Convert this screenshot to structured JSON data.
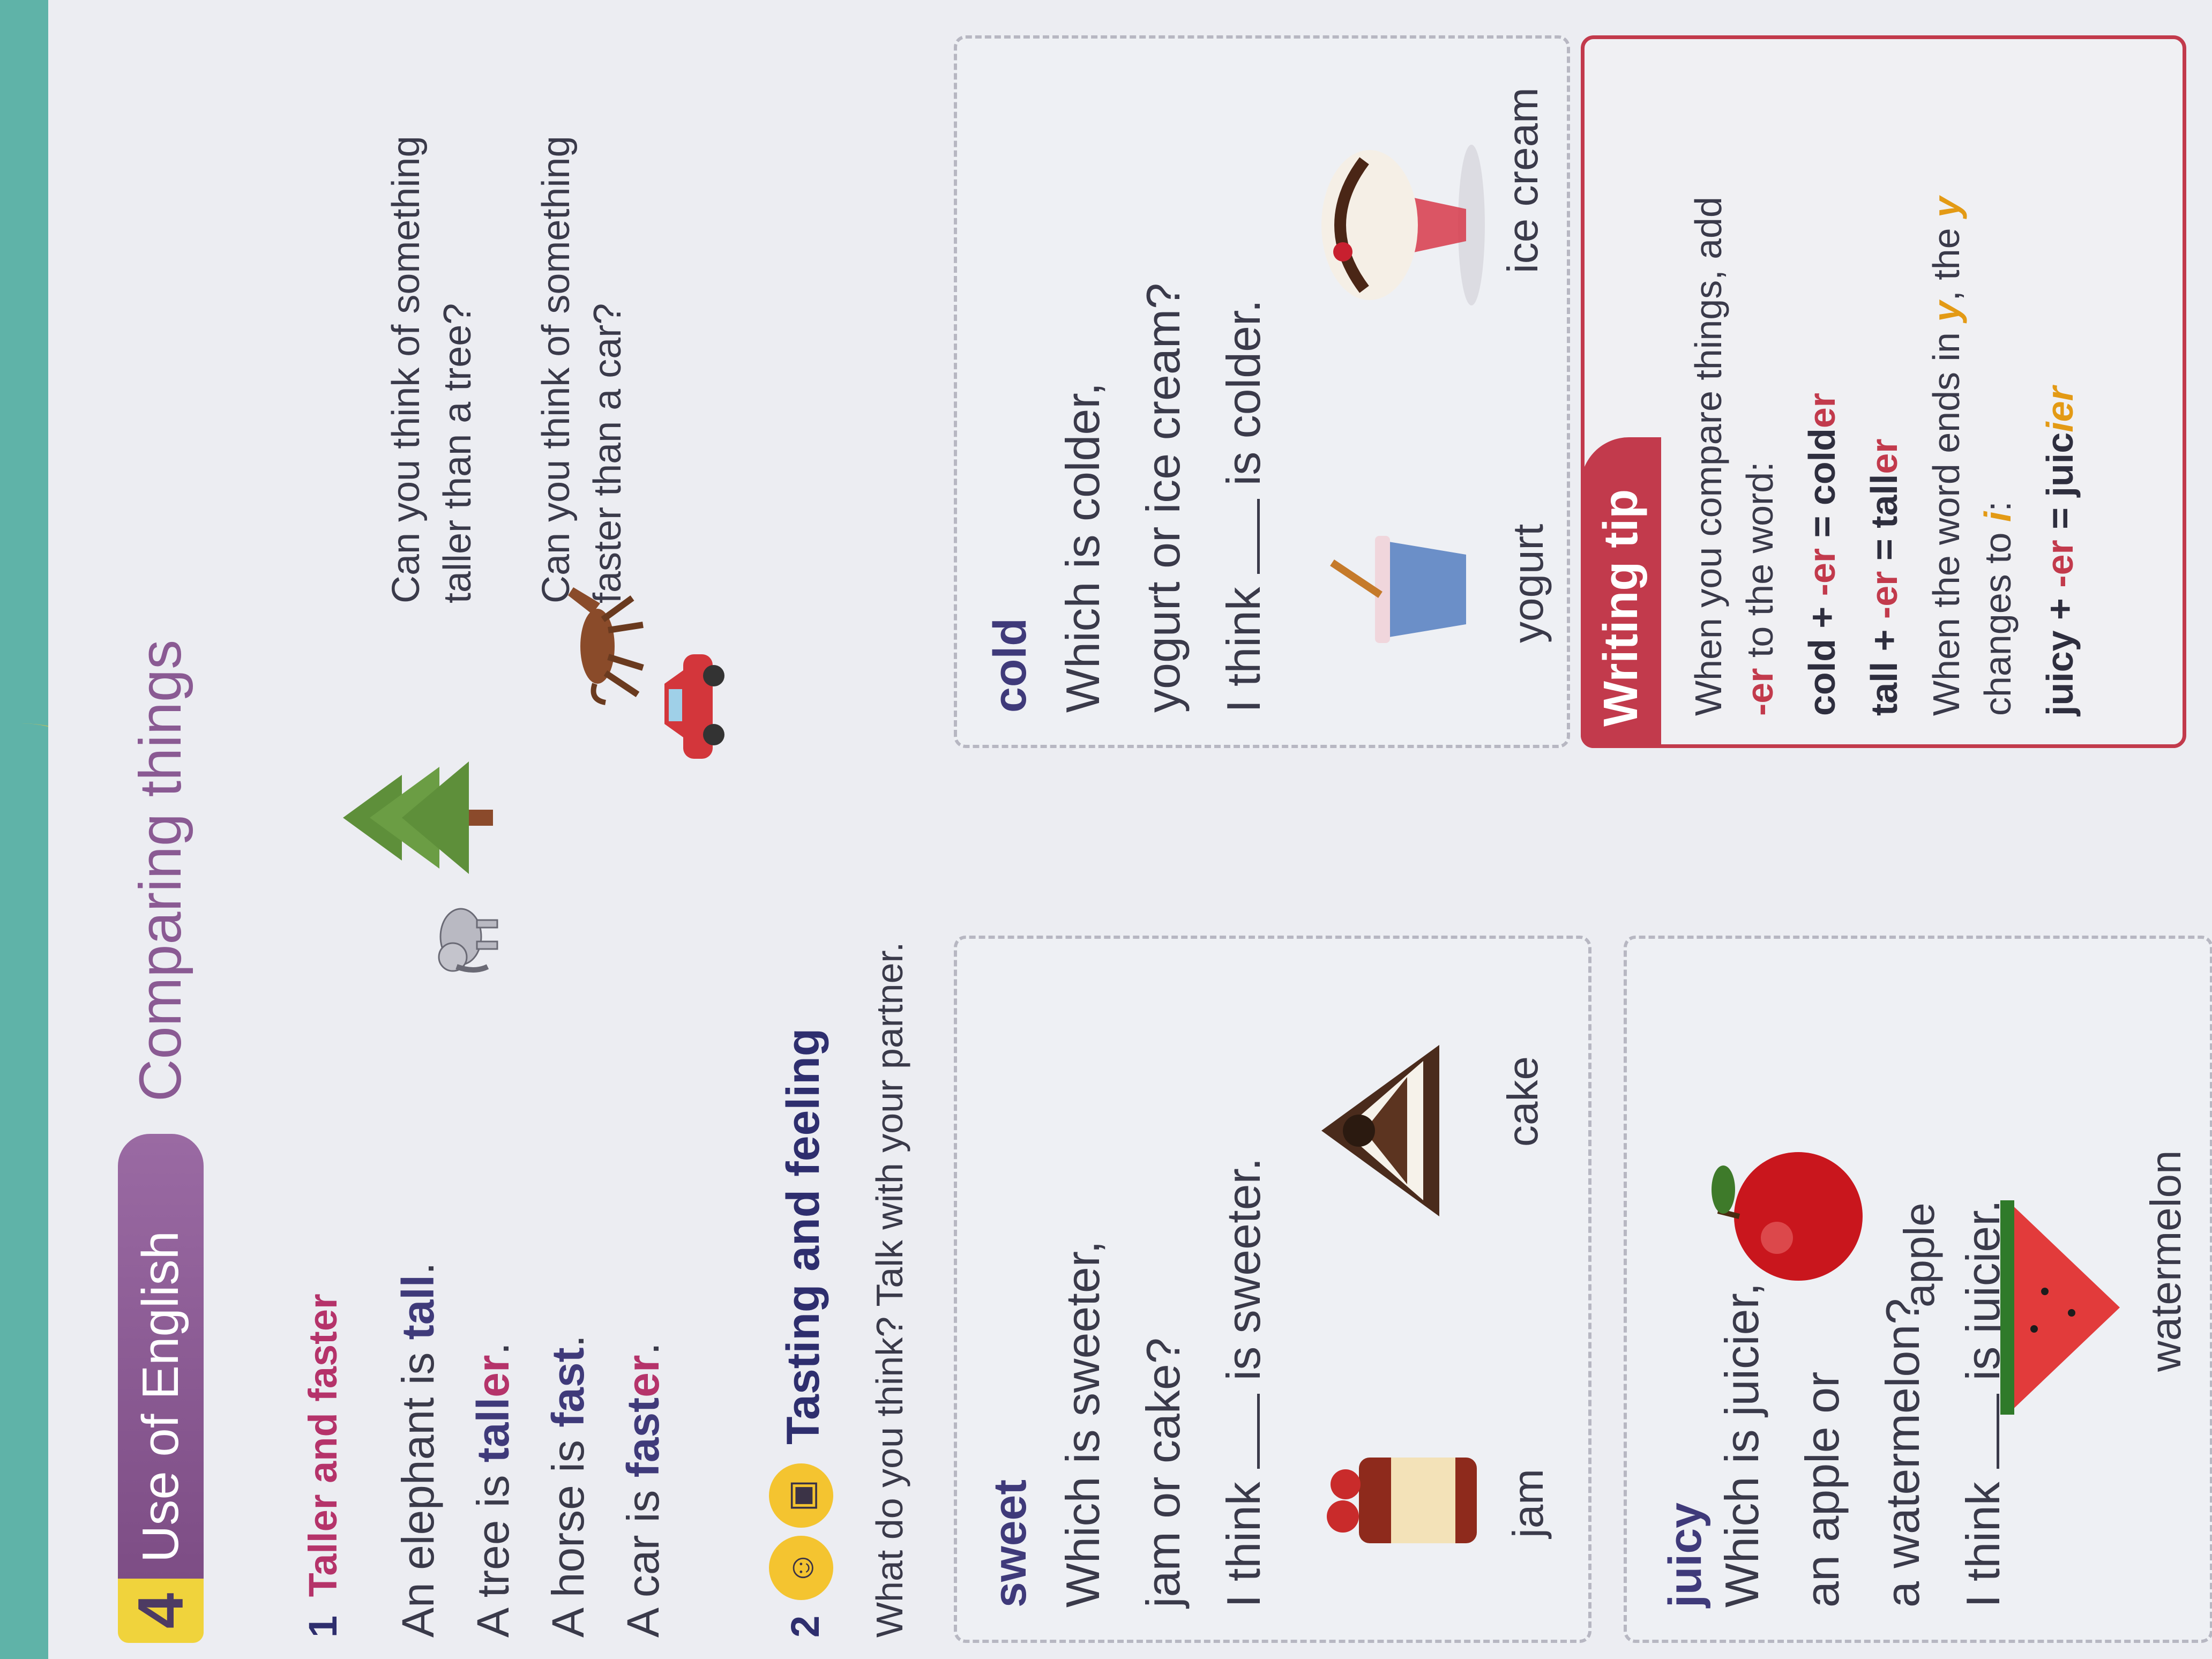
{
  "header": {
    "unit_number": "4",
    "unit_title": "Use of English",
    "section_title": "Comparing things"
  },
  "exercise1": {
    "number": "1",
    "heading": "Taller and faster",
    "lines": [
      {
        "before": "An elephant is ",
        "word": "tall",
        "after": "."
      },
      {
        "before": "A tree is ",
        "word_stem": "tall",
        "word_suffix": "er",
        "after": "."
      },
      {
        "before": "A horse is ",
        "word": "fast",
        "after": "."
      },
      {
        "before": "A car is ",
        "word_stem": "fast",
        "word_suffix": "er",
        "after": "."
      }
    ],
    "prompts": [
      "Can you think of something taller than a tree?",
      "Can you think of something faster than a car?"
    ],
    "pictures": [
      "elephant",
      "tree",
      "horse",
      "car"
    ]
  },
  "exercise2": {
    "number": "2",
    "heading": "Tasting and feeling",
    "instruction": "What do you think? Talk with your partner.",
    "cards": [
      {
        "title": "sweet",
        "question_lines": [
          "Which is sweeter,",
          "jam or cake?"
        ],
        "answer_before": "I think",
        "answer_after": "is sweeter.",
        "items": [
          "jam",
          "cake"
        ]
      },
      {
        "title": "cold",
        "question_lines": [
          "Which is colder,",
          "yogurt or ice cream?"
        ],
        "answer_before": "I think",
        "answer_after": "is colder.",
        "items": [
          "yogurt",
          "ice cream"
        ]
      },
      {
        "title": "juicy",
        "question_lines": [
          "Which is juicier,",
          "an apple or",
          "a watermelon?"
        ],
        "answer_before": "I think",
        "answer_after": "is juicier.",
        "items": [
          "apple",
          "watermelon"
        ]
      }
    ]
  },
  "writing_tip": {
    "tab_label": "Writing tip",
    "intro_1": "When you compare things, add",
    "intro_2_accent": "-er",
    "intro_2_rest": " to the word:",
    "ex1_base": "cold + ",
    "ex1_suffix": "-er",
    "ex1_eq": " = cold",
    "ex1_end": "er",
    "ex2_base": "tall + ",
    "ex2_suffix": "-er",
    "ex2_eq": " = tall",
    "ex2_end": "er",
    "rule_1a": "When the word ends in ",
    "rule_y": "y",
    "rule_1b": ", the ",
    "rule_y2": "y",
    "rule_2a": "changes to ",
    "rule_i": "i",
    "rule_2b": ":",
    "ex3_base": "juicy + ",
    "ex3_suffix": "-er",
    "ex3_eq": " = juic",
    "ex3_end": "ier"
  },
  "colors": {
    "accent_red": "#c23a4c",
    "purple": "#8a5a93",
    "yellow": "#f0d33c"
  }
}
